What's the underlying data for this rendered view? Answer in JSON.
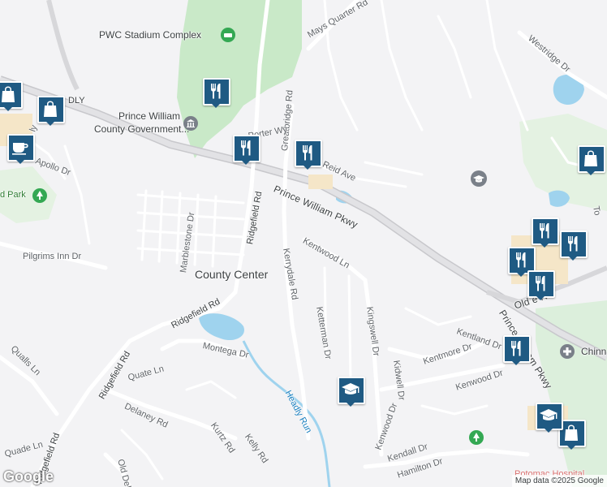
{
  "map": {
    "colors": {
      "background": "#f3f3f5",
      "road": "#ffffff",
      "highway": "#d7d7da",
      "park": "#c9e9c8",
      "water": "#9fd3ee",
      "pin": "#1f5a83"
    }
  },
  "labels": {
    "pwc_stadium": "PWC Stadium Complex",
    "pw_county_gov_1": "Prince William",
    "pw_county_gov_2": "County Government...",
    "county_center": "County Center",
    "mays_quarter_rd": "Mays Quarter Rd",
    "westridge_dr": "Westridge Dr",
    "greatbridge_rd": "Greatbridge Rd",
    "reid_ave": "Reid Ave",
    "porter_wy": "Porter Wy",
    "prince_william_pkwy_1": "Prince William Pkwy",
    "prince_william_pkwy_2": "Prince William Pkwy",
    "ridgefield_rd_1": "Ridgefield Rd",
    "ridgefield_rd_2": "Ridgefield Rd",
    "ridgefield_rd_3": "Ridgefield Rd",
    "ridgefield_rd_4": "Ridgefield Rd",
    "marblestone_dr": "Marblestone Dr",
    "pilgrims_inn_dr": "Pilgrims Inn Dr",
    "apollo_dr": "Apollo Dr",
    "park_fragment": "d Park",
    "kentwood_ln": "Kentwood Ln",
    "kerrydale_rd": "Kerrydale Rd",
    "ketterman_dr": "Ketterman Dr",
    "kingswell_dr": "Kingswell Dr",
    "kidwell_dr": "Kidwell Dr",
    "kentland_dr": "Kentland Dr",
    "kentmore_dr": "Kentmore Dr",
    "kenwood_dr_1": "Kenwood Dr",
    "kenwood_dr_2": "Kenwood Dr",
    "old_bridge_rd": "Old        e Rd",
    "montega_dr": "Montega Dr",
    "quate_ln": "Quate Ln",
    "qualls_ln": "Qualls Ln",
    "quade_ln": "Quade Ln",
    "delaney_rd": "Delaney Rd",
    "kurtz_rd": "Kurtz Rd",
    "kelly_rd": "Kelly Rd",
    "old_dela": "Old Dela",
    "headly_run": "Headly Run",
    "kendall_dr": "Kendall Dr",
    "hamilton_dr": "Hamilton Dr",
    "chinn_fragment": "Chinn",
    "to_fragment": "To",
    "dly_fragment": "DLY",
    "ly_fragment": "ly",
    "potomac_fragment": "Potomac Hospital"
  },
  "pins": [
    {
      "type": "restaurant",
      "icon": "fork-knife-icon"
    },
    {
      "type": "restaurant",
      "icon": "fork-knife-icon"
    },
    {
      "type": "restaurant",
      "icon": "fork-knife-icon"
    },
    {
      "type": "shopping",
      "icon": "shopping-bag-icon"
    },
    {
      "type": "shopping",
      "icon": "shopping-bag-icon"
    },
    {
      "type": "cafe",
      "icon": "coffee-cup-icon"
    },
    {
      "type": "school",
      "icon": "graduation-cap-icon"
    },
    {
      "type": "restaurant",
      "icon": "fork-knife-icon"
    },
    {
      "type": "restaurant",
      "icon": "fork-knife-icon"
    },
    {
      "type": "restaurant",
      "icon": "fork-knife-icon"
    },
    {
      "type": "restaurant",
      "icon": "fork-knife-icon"
    },
    {
      "type": "shopping",
      "icon": "shopping-bag-icon"
    },
    {
      "type": "shopping",
      "icon": "shopping-bag-icon"
    },
    {
      "type": "school",
      "icon": "graduation-cap-icon"
    }
  ],
  "branding": {
    "logo": "Google",
    "attribution": "Map data ©2025 Google"
  }
}
